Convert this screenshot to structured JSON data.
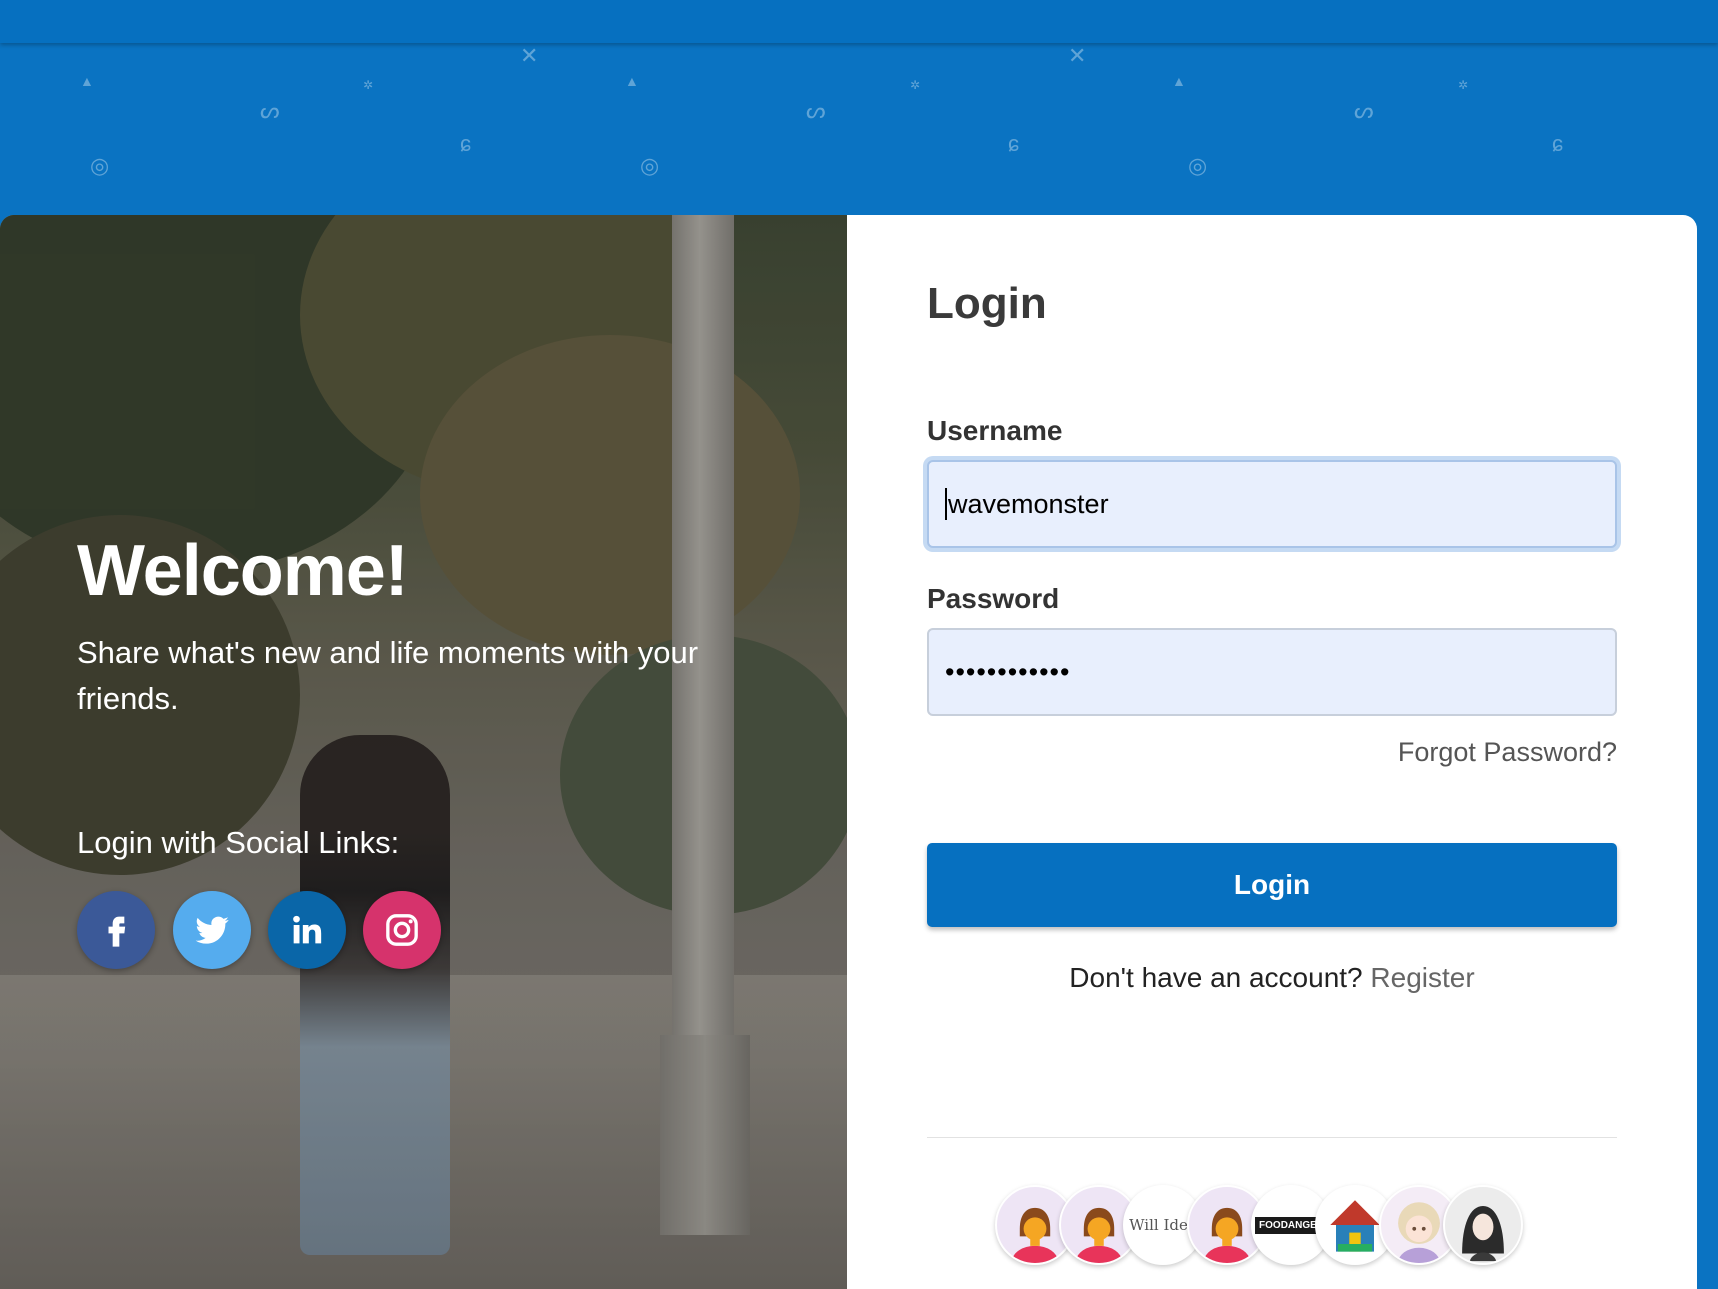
{
  "hero": {
    "title": "Welcome!",
    "tagline": "Share what's new and life moments with your friends.",
    "social_label": "Login with Social Links:",
    "social": [
      {
        "name": "facebook",
        "icon": "facebook-icon",
        "color": "#3b5998"
      },
      {
        "name": "twitter",
        "icon": "twitter-icon",
        "color": "#55acee"
      },
      {
        "name": "linkedin",
        "icon": "linkedin-icon",
        "color": "#0a66a8"
      },
      {
        "name": "instagram",
        "icon": "instagram-icon",
        "color": "#d6336c"
      }
    ]
  },
  "form": {
    "title": "Login",
    "username_label": "Username",
    "username_value": "wavemonster",
    "password_label": "Password",
    "password_value": "••••••••••••",
    "forgot_link": "Forgot Password?",
    "login_button": "Login",
    "register_prompt": "Don't have an account?",
    "register_link": "Register"
  },
  "avatars": [
    {
      "type": "female-user-icon"
    },
    {
      "type": "female-user-icon"
    },
    {
      "type": "logo",
      "text": "Will Idea"
    },
    {
      "type": "female-user-icon"
    },
    {
      "type": "logo",
      "text": "FOODANGEL"
    },
    {
      "type": "house-logo"
    },
    {
      "type": "anime-girl"
    },
    {
      "type": "anime-boy"
    }
  ],
  "colors": {
    "brand_blue": "#0670c0",
    "input_bg": "#e8effd"
  }
}
